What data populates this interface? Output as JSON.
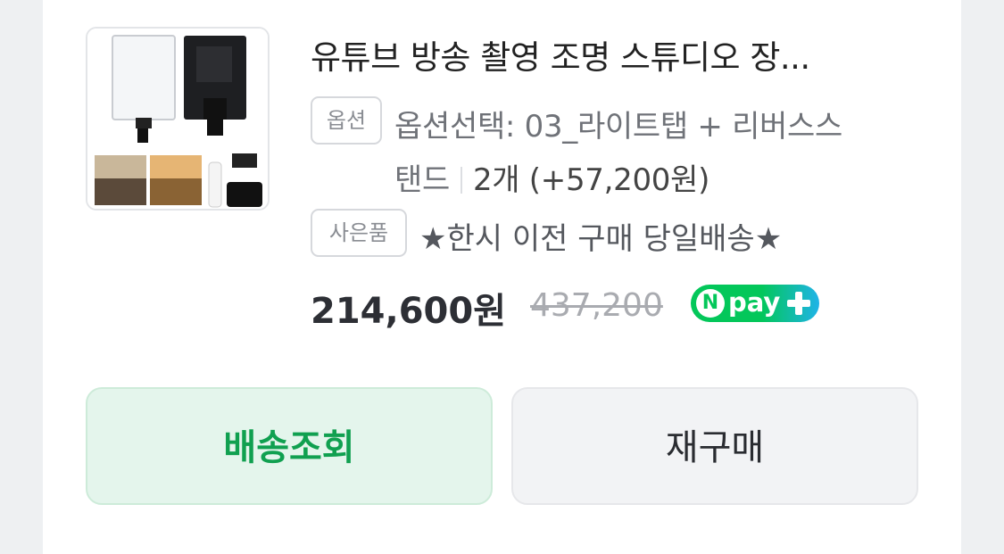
{
  "product": {
    "title": "유튜브 방송 촬영 조명 스튜디오 장...",
    "image_icon": "product-photo-led-light-panel-set"
  },
  "option": {
    "tag": "옵션",
    "line1": "옵션선택: 03_라이트탭 + 리버스스",
    "line2_text": "탠드",
    "quantity": "2개 (+57,200원)"
  },
  "gift": {
    "tag": "사은품",
    "text": "★한시 이전 구매 당일배송★"
  },
  "price": {
    "current": "214,600원",
    "original": "437,200",
    "pay_badge": "pay"
  },
  "buttons": {
    "shipping": "배송조회",
    "rebuy": "재구매"
  },
  "colors": {
    "accent_green": "#03c75a",
    "ship_text": "#10a050",
    "ship_bg": "#e4f5ec"
  }
}
